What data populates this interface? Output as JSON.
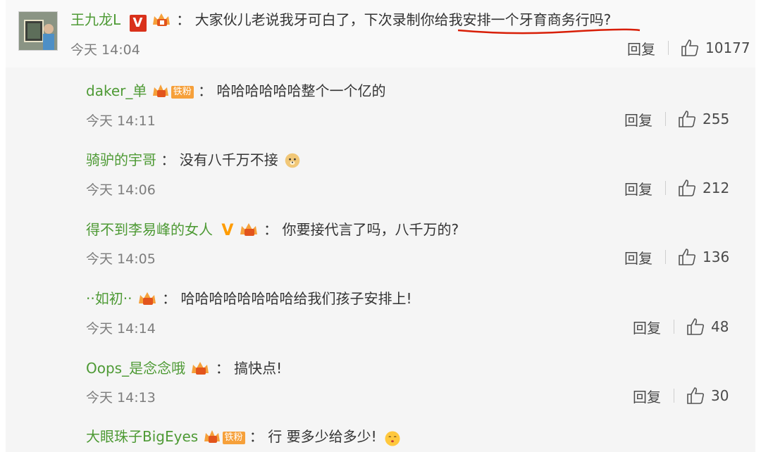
{
  "top_comment": {
    "username": "王九龙L",
    "separator": "：",
    "text": "大家伙儿老说我牙可白了，下次录制你给我安排一个牙育商务行吗?",
    "time": "今天 14:04",
    "reply_label": "回复",
    "likes": "10177"
  },
  "replies": [
    {
      "username": "daker_单",
      "fan_badge": "铁粉",
      "separator": "：",
      "text": "哈哈哈哈哈哈整个一个亿的",
      "time": "今天 14:11",
      "reply_label": "回复",
      "likes": "255"
    },
    {
      "username": "骑驴的宇哥",
      "separator": "：",
      "text": "没有八千万不接",
      "time": "今天 14:06",
      "reply_label": "回复",
      "likes": "212"
    },
    {
      "username": "得不到李易峰的女人",
      "separator": "：",
      "text": "你要接代言了吗，八千万的?",
      "time": "今天 14:05",
      "reply_label": "回复",
      "likes": "136"
    },
    {
      "username": "··如初··",
      "separator": "：",
      "text": "哈哈哈哈哈哈哈哈给我们孩子安排上!",
      "time": "今天 14:14",
      "reply_label": "回复",
      "likes": "48"
    },
    {
      "username": "Oops_是念念哦",
      "separator": "：",
      "text": "搞快点!",
      "time": "今天 14:13",
      "reply_label": "回复",
      "likes": "30"
    },
    {
      "username": "大眼珠子BigEyes",
      "fan_badge": "铁粉",
      "separator": "：",
      "text": "行 要多少给多少!",
      "time": "",
      "reply_label": "",
      "likes": ""
    }
  ],
  "colors": {
    "username": "#4e9a35",
    "text": "#333333",
    "time": "#7d7d7d",
    "highlight_underline": "#d81e06"
  },
  "icons": [
    "avatar-image",
    "verified-v-icon",
    "crown-badge-icon",
    "like-thumb-icon",
    "doge-emoji-icon",
    "kiss-emoji-icon"
  ]
}
